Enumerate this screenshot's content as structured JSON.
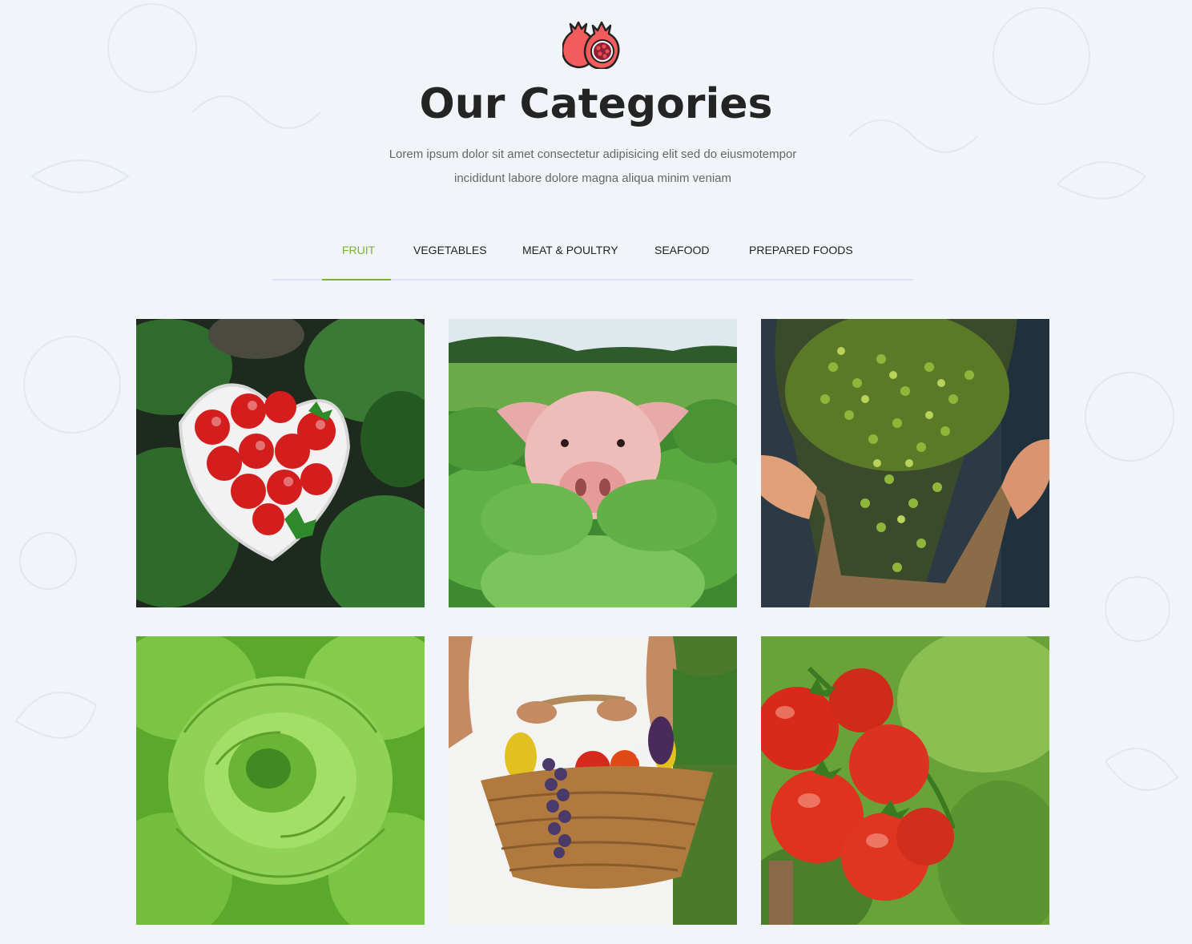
{
  "section": {
    "title": "Our Categories",
    "subtitle_line1": "Lorem ipsum dolor sit amet consectetur adipisicing elit sed do eiusmotempor",
    "subtitle_line2": "incididunt labore dolore magna aliqua minim veniam"
  },
  "logo": {
    "icon": "pomegranate-icon"
  },
  "tabs": [
    {
      "label": "FRUIT",
      "active": true
    },
    {
      "label": "VEGETABLES",
      "active": false
    },
    {
      "label": "MEAT & POULTRY",
      "active": false
    },
    {
      "label": "SEAFOOD",
      "active": false
    },
    {
      "label": "PREPARED FOODS",
      "active": false
    }
  ],
  "gallery": [
    {
      "image": "strawberries-heart-bowl"
    },
    {
      "image": "pig-in-cabbage-field"
    },
    {
      "image": "olives-harvest-sack"
    },
    {
      "image": "lettuce-closeup"
    },
    {
      "image": "vegetable-basket"
    },
    {
      "image": "tomatoes-on-vine"
    }
  ],
  "colors": {
    "accent": "#7ab22a",
    "background": "#f1f5f9",
    "tab_border": "#dde3f6",
    "title": "#242424"
  }
}
